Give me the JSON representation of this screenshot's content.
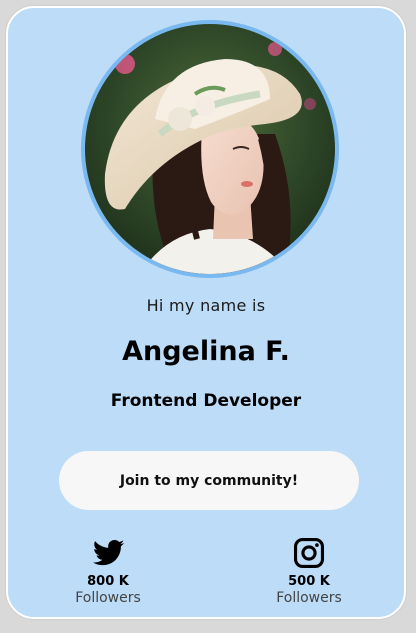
{
  "profile": {
    "greeting": "Hi my name is",
    "name": "Angelina F.",
    "role": "Frontend Developer",
    "avatar_alt": "profile photo of woman in sun hat"
  },
  "cta": {
    "label": "Join to my community!"
  },
  "social": [
    {
      "network": "twitter",
      "icon": "twitter-icon",
      "count": "800 K",
      "label": "Followers"
    },
    {
      "network": "instagram",
      "icon": "instagram-icon",
      "count": "500 K",
      "label": "Followers"
    }
  ],
  "colors": {
    "card_background": "#bcdcf7",
    "avatar_ring": "#79b9f0",
    "button_background": "#f7f7f7"
  }
}
